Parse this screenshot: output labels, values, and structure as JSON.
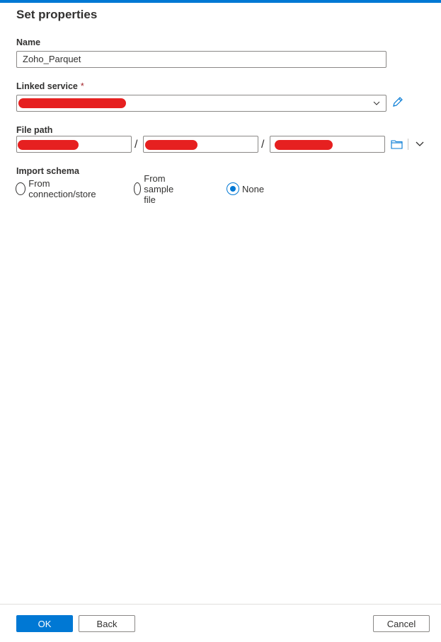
{
  "panel": {
    "title": "Set properties"
  },
  "name_field": {
    "label": "Name",
    "value": "Zoho_Parquet"
  },
  "linked_service": {
    "label": "Linked service",
    "required_mark": "*",
    "value": ""
  },
  "file_path": {
    "label": "File path",
    "separator": "/",
    "segments": [
      "",
      "",
      ""
    ]
  },
  "import_schema": {
    "label": "Import schema",
    "options": [
      "From connection/store",
      "From sample file",
      "None"
    ],
    "selected": "None"
  },
  "footer": {
    "ok_label": "OK",
    "back_label": "Back",
    "cancel_label": "Cancel"
  },
  "colors": {
    "accent": "#0078d4",
    "redaction": "#e62020",
    "required": "#a4262c"
  }
}
